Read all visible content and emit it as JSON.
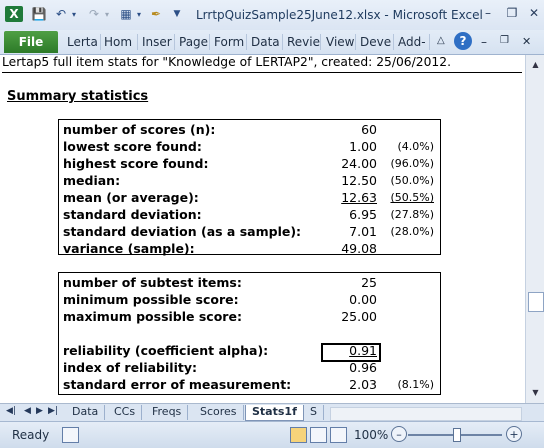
{
  "window": {
    "title": "LrrtpQuizSample25June12.xlsx  -  Microsoft Excel",
    "app_icon": "excel-icon"
  },
  "ribbon": {
    "file_tab": "File",
    "tabs": [
      "Lerta",
      "Hom",
      "Inser",
      "Page",
      "Form",
      "Data",
      "Revie",
      "View",
      "Deve",
      "Add-"
    ]
  },
  "sheet": {
    "header_text": "Lertap5 full item stats for \"Knowledge of LERTAP2\", created: 25/06/2012.",
    "section_title": "Summary statistics",
    "summary1": [
      {
        "label": "number of scores (n):",
        "value": "60",
        "pct": ""
      },
      {
        "label": "lowest score found:",
        "value": "1.00",
        "pct": "(4.0%)"
      },
      {
        "label": "highest score found:",
        "value": "24.00",
        "pct": "(96.0%)"
      },
      {
        "label": "median:",
        "value": "12.50",
        "pct": "(50.0%)"
      },
      {
        "label": "mean (or average):",
        "value": "12.63",
        "pct": "(50.5%)"
      },
      {
        "label": "standard deviation:",
        "value": "6.95",
        "pct": "(27.8%)"
      },
      {
        "label": "standard deviation (as a sample):",
        "value": "7.01",
        "pct": "(28.0%)"
      },
      {
        "label": "variance (sample):",
        "value": "49.08",
        "pct": ""
      }
    ],
    "summary2": [
      {
        "label": "number of subtest items:",
        "value": "25",
        "pct": ""
      },
      {
        "label": "minimum possible score:",
        "value": "0.00",
        "pct": ""
      },
      {
        "label": "maximum possible score:",
        "value": "25.00",
        "pct": ""
      },
      {
        "label": "reliability (coefficient alpha):",
        "value": "0.91",
        "pct": ""
      },
      {
        "label": "index of reliability:",
        "value": "0.96",
        "pct": ""
      },
      {
        "label": "standard error of measurement:",
        "value": "2.03",
        "pct": "(8.1%)"
      }
    ]
  },
  "sheet_tabs": {
    "tabs": [
      "Data",
      "CCs",
      "Freqs",
      "Scores",
      "Stats1f",
      "S"
    ],
    "active": "Stats1f"
  },
  "status": {
    "text": "Ready",
    "zoom": "100%",
    "zoom_level_percent": 100
  }
}
